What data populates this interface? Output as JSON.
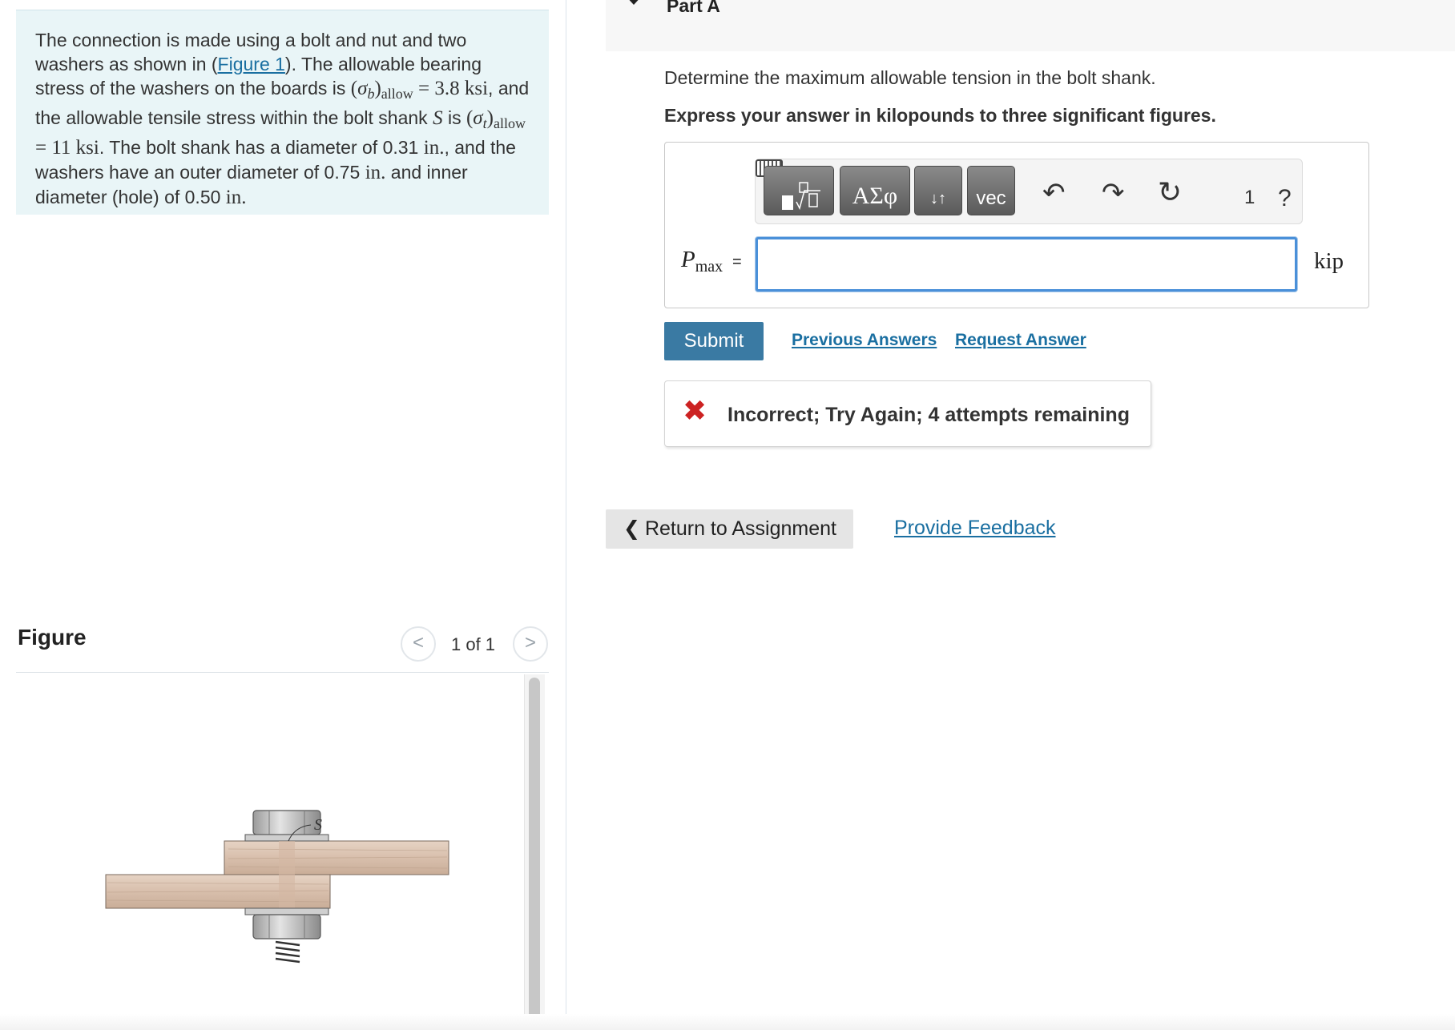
{
  "problem": {
    "intro": "The connection is made using a bolt and nut and two washers as shown in (",
    "figure_link": "Figure 1",
    "after_link": "). The allowable bearing stress of the washers on the boards is",
    "sigma_b": "σ",
    "sigma_b_sub": "b",
    "allow_sub": "allow",
    "sigma_b_value": "= 3.8 ksi",
    "mid_text": ", and the allowable tensile stress within the bolt shank",
    "shank_symbol": "S",
    "is_text": "is",
    "sigma_t": "σ",
    "sigma_t_sub": "t",
    "sigma_t_value": "= 11 ksi",
    "rest_text_1": ". The bolt shank has a diameter of 0.31",
    "unit_in_1": "in.",
    "rest_text_2": ", and the washers have an outer diameter of 0.75",
    "unit_in_2": "in.",
    "rest_text_3": "and inner diameter (hole) of 0.50",
    "unit_in_3": "in."
  },
  "figure": {
    "title": "Figure",
    "page_count": "1 of 1",
    "prev_glyph": "<",
    "next_glyph": ">",
    "label_s": "S"
  },
  "part": {
    "title": "Part A",
    "question": "Determine the maximum allowable tension in the bolt shank.",
    "instruction": "Express your answer in kilopounds to three significant figures."
  },
  "answer": {
    "variable": "P",
    "variable_sub": "max",
    "equals": "=",
    "value": "",
    "unit": "kip"
  },
  "toolbar": {
    "greek": "ΑΣφ",
    "arrows": "↓↑",
    "vec": "vec",
    "undo": "↶",
    "redo": "↷",
    "reset": "↻",
    "keyboard_number": "1",
    "help": "?"
  },
  "actions": {
    "submit": "Submit",
    "previous_answers": "Previous Answers",
    "request_answer": "Request Answer"
  },
  "feedback": {
    "icon": "✖",
    "message": "Incorrect; Try Again; 4 attempts remaining"
  },
  "footer": {
    "return_chevron": "❮",
    "return_label": "Return to Assignment",
    "provide_feedback": "Provide Feedback"
  },
  "colors": {
    "accent": "#3a7aa3",
    "link": "#1a6fa1",
    "error": "#cc2222",
    "problem_bg": "#e9f5f7"
  }
}
